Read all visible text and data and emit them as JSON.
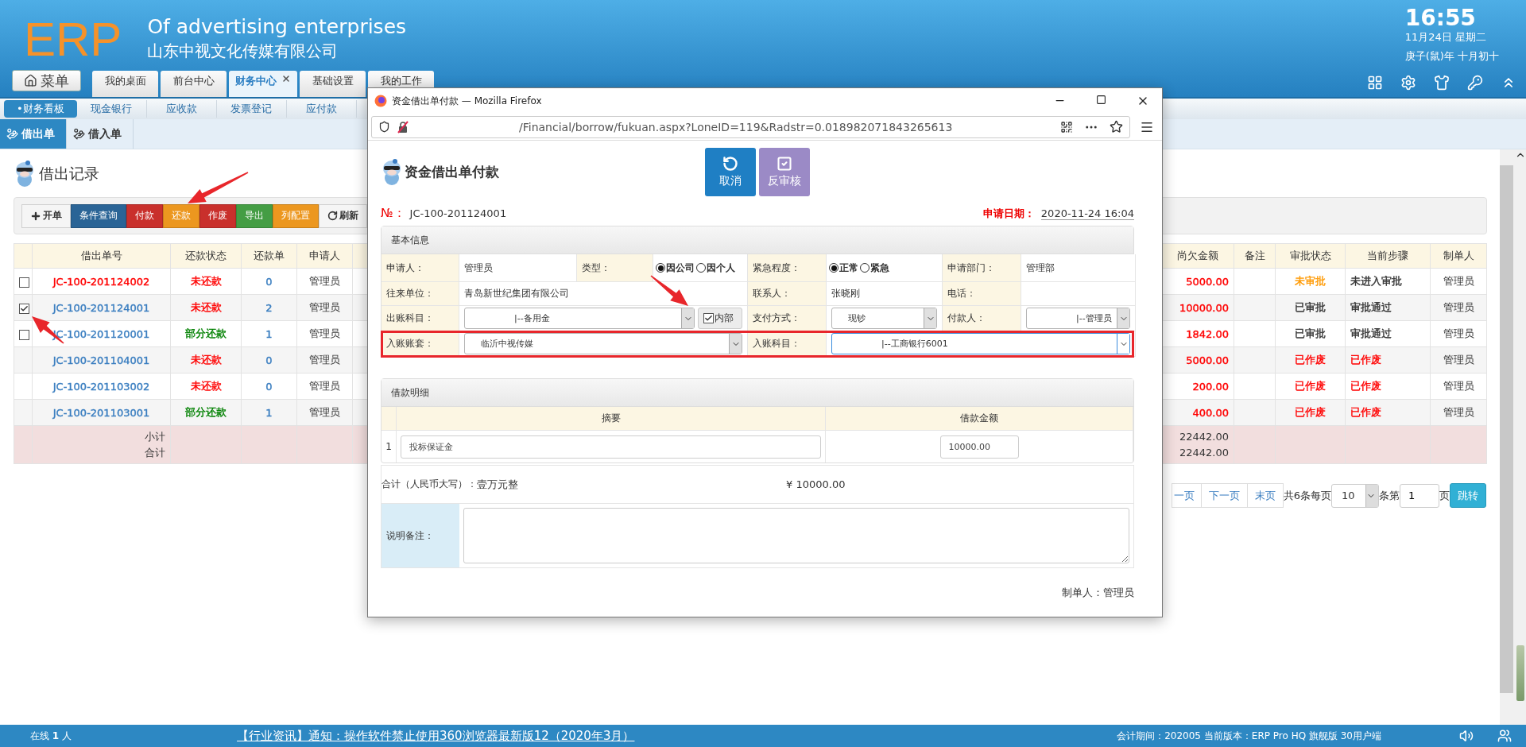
{
  "header": {
    "logo": "ERP",
    "tagline": "Of advertising enterprises",
    "company": "山东中视文化传媒有限公司",
    "clock": {
      "time": "16:55",
      "date": "11月24日 星期二",
      "lunar": "庚子(鼠)年 十月初十"
    }
  },
  "menu_button": "菜单",
  "main_tabs": [
    {
      "label": "我的桌面",
      "selected": false,
      "closable": false
    },
    {
      "label": "前台中心",
      "selected": false,
      "closable": false
    },
    {
      "label": "财务中心",
      "selected": true,
      "closable": true
    },
    {
      "label": "基础设置",
      "selected": false,
      "closable": false
    },
    {
      "label": "我的工作",
      "selected": false,
      "closable": false
    }
  ],
  "sub_nav": [
    {
      "label": "•财务看板",
      "selected": true
    },
    {
      "label": "现金银行",
      "selected": false
    },
    {
      "label": "应收款",
      "selected": false
    },
    {
      "label": "发票登记",
      "selected": false
    },
    {
      "label": "应付款",
      "selected": false
    }
  ],
  "page_tabs": [
    {
      "label": "借出单",
      "selected": true
    },
    {
      "label": "借入单",
      "selected": false
    }
  ],
  "page_title": "借出记录",
  "toolbar": [
    {
      "label": "开单",
      "kind": "add",
      "color": "#f5f5f5"
    },
    {
      "label": "条件查询",
      "kind": "action",
      "color": "#2a6496"
    },
    {
      "label": "付款",
      "kind": "action",
      "color": "#c9302c"
    },
    {
      "label": "还款",
      "kind": "action",
      "color": "#ec971f"
    },
    {
      "label": "作废",
      "kind": "action",
      "color": "#c9302c"
    },
    {
      "label": "导出",
      "kind": "action",
      "color": "#449d44"
    },
    {
      "label": "列配置",
      "kind": "action",
      "color": "#ec971f"
    },
    {
      "label": "刷新",
      "kind": "refresh",
      "color": "#f5f5f5"
    }
  ],
  "table": {
    "columns": [
      "借出单号",
      "还款状态",
      "还款单",
      "申请人",
      "尚欠金额",
      "备注",
      "审批状态",
      "当前步骤",
      "制单人"
    ],
    "rows": [
      {
        "checked": false,
        "number": {
          "text": "JC-100-201124002",
          "color": "#ff0000"
        },
        "status": {
          "text": "未还款",
          "color": "#ff0000"
        },
        "repay_count": "0",
        "applicant": "管理员",
        "outstanding": "5000.00",
        "approval": {
          "text": "未审批",
          "color": "#ff9900"
        },
        "step": {
          "text": "未进入审批",
          "color": "#333333"
        },
        "maker": "管理员"
      },
      {
        "checked": true,
        "number": {
          "text": "JC-100-201124001",
          "color": "#3a7ec0"
        },
        "status": {
          "text": "未还款",
          "color": "#ff0000"
        },
        "repay_count": "2",
        "applicant": "管理员",
        "outstanding": "10000.00",
        "approval": {
          "text": "已审批",
          "color": "#333333"
        },
        "step": {
          "text": "审批通过",
          "color": "#333333"
        },
        "maker": "管理员"
      },
      {
        "checked": false,
        "number": {
          "text": "JC-100-201120001",
          "color": "#3a7ec0"
        },
        "status": {
          "text": "部分还款",
          "color": "#008000"
        },
        "repay_count": "1",
        "applicant": "管理员",
        "outstanding": "1842.00",
        "approval": {
          "text": "已审批",
          "color": "#333333"
        },
        "step": {
          "text": "审批通过",
          "color": "#333333"
        },
        "maker": "管理员"
      },
      {
        "number": {
          "text": "JC-100-201104001",
          "color": "#3a7ec0"
        },
        "status": {
          "text": "未还款",
          "color": "#ff0000"
        },
        "repay_count": "0",
        "applicant": "管理员",
        "outstanding": "5000.00",
        "approval": {
          "text": "已作废",
          "color": "#ff0000"
        },
        "step": {
          "text": "已作废",
          "color": "#ff0000"
        },
        "maker": "管理员"
      },
      {
        "number": {
          "text": "JC-100-201103002",
          "color": "#3a7ec0"
        },
        "status": {
          "text": "未还款",
          "color": "#ff0000"
        },
        "repay_count": "0",
        "applicant": "管理员",
        "outstanding": "200.00",
        "approval": {
          "text": "已作废",
          "color": "#ff0000"
        },
        "step": {
          "text": "已作废",
          "color": "#ff0000"
        },
        "maker": "管理员"
      },
      {
        "number": {
          "text": "JC-100-201103001",
          "color": "#3a7ec0"
        },
        "status": {
          "text": "部分还款",
          "color": "#008000"
        },
        "repay_count": "1",
        "applicant": "管理员",
        "outstanding": "400.00",
        "approval": {
          "text": "已作废",
          "color": "#ff0000"
        },
        "step": {
          "text": "已作废",
          "color": "#ff0000"
        },
        "maker": "管理员"
      }
    ],
    "totals": {
      "subtotal_label": "小计",
      "total_label": "合计",
      "subtotal": "22442.00",
      "total": "22442.00"
    }
  },
  "pagination": {
    "prev": "一页",
    "next": "下一页",
    "last": "末页",
    "summary": "共6条每页",
    "page_size": "10",
    "between": "条第",
    "page": "1",
    "suffix": "页",
    "go": "跳转"
  },
  "popup": {
    "window_title": "资金借出单付款 — Mozilla Firefox",
    "url": "/Financial/borrow/fukuan.aspx?LoneID=119&Radstr=0.018982071843265613",
    "title": "资金借出单付款",
    "actions": [
      {
        "label": "取消",
        "kind": "undo",
        "color": "#1f7fc4"
      },
      {
        "label": "反审核",
        "kind": "check",
        "color": "#9b8ac6"
      }
    ],
    "number_label": "№：",
    "number": "JC-100-201124001",
    "date_label": "申请日期：",
    "date": "2020-11-24 16:04",
    "basic": {
      "heading": "基本信息",
      "rows": [
        {
          "highlighted": false,
          "cells": [
            {
              "kind": "label",
              "text": "申请人："
            },
            {
              "kind": "text",
              "text": "管理员"
            },
            {
              "kind": "label",
              "text": "类型："
            },
            {
              "kind": "radio",
              "options": [
                {
                  "label": "因公司",
                  "selected": true
                },
                {
                  "label": "因个人",
                  "selected": false
                }
              ]
            },
            {
              "kind": "label",
              "text": "紧急程度："
            },
            {
              "kind": "radio",
              "options": [
                {
                  "label": "正常",
                  "selected": true
                },
                {
                  "label": "紧急",
                  "selected": false
                }
              ]
            },
            {
              "kind": "label",
              "text": "申请部门："
            },
            {
              "kind": "text",
              "text": "管理部"
            }
          ]
        },
        {
          "highlighted": false,
          "cells": [
            {
              "kind": "label",
              "text": "往来单位："
            },
            {
              "kind": "text",
              "text": "青岛新世纪集团有限公司"
            },
            {
              "kind": "merged"
            },
            {
              "kind": "merged"
            },
            {
              "kind": "label",
              "text": "联系人："
            },
            {
              "kind": "text",
              "text": "张晓刚"
            },
            {
              "kind": "label",
              "text": "电话："
            },
            {
              "kind": "empty"
            }
          ]
        },
        {
          "highlighted": false,
          "cells": [
            {
              "kind": "label",
              "text": "出账科目："
            },
            {
              "kind": "select",
              "value": "|--备用金",
              "focused": false,
              "check": {
                "label": "内部",
                "checked": true
              }
            },
            {
              "kind": "merged"
            },
            {
              "kind": "merged"
            },
            {
              "kind": "label",
              "text": "支付方式："
            },
            {
              "kind": "select",
              "value": "现钞",
              "focused": false
            },
            {
              "kind": "label",
              "text": "付款人："
            },
            {
              "kind": "select",
              "value": "|--管理员",
              "focused": false
            }
          ]
        },
        {
          "highlighted": true,
          "cells": [
            {
              "kind": "label",
              "text": "入账账套："
            },
            {
              "kind": "select",
              "value": "临沂中视传媒",
              "focused": false
            },
            {
              "kind": "merged"
            },
            {
              "kind": "merged"
            },
            {
              "kind": "label",
              "text": "入账科目："
            },
            {
              "kind": "select",
              "value": "|--工商银行6001",
              "focused": true
            },
            {
              "kind": "merged"
            },
            {
              "kind": "merged"
            }
          ]
        }
      ]
    },
    "details": {
      "heading": "借款明细",
      "columns": [
        "摘要",
        "借款金额"
      ],
      "rows": [
        {
          "index": "1",
          "summary": "投标保证金",
          "amount": "10000.00"
        }
      ],
      "total_label": "合计（人民币大写）：",
      "total_words": "壹万元整",
      "total_amount": "¥ 10000.00",
      "remark_label": "说明备注："
    },
    "maker": "制单人：管理员"
  },
  "status_bar": {
    "online_label": "在线",
    "online_count": "1",
    "online_unit": "人",
    "notice": "【行业资讯】通知：操作软件禁止使用360浏览器最新版12（2020年3月）",
    "info": "会计期间：202005 当前版本：ERP Pro HQ 旗舰版 30用户端"
  }
}
